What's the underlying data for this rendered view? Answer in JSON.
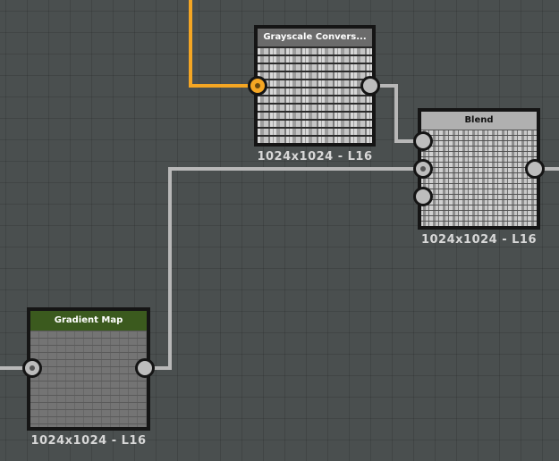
{
  "colors": {
    "canvas": "#4a4f4f",
    "wire_gray": "#b8b8b8",
    "wire_orange": "#f5a623",
    "node_frame": "#151515",
    "gradient_map_header": "#3b5a1e",
    "grayscale_header": "#6b6b6b",
    "blend_header": "#b0b0b0"
  },
  "nodes": {
    "grayscale": {
      "title": "Grayscale Convers...",
      "resolution": "1024x1024 - L16"
    },
    "blend": {
      "title": "Blend",
      "resolution": "1024x1024 - L16"
    },
    "gradient_map": {
      "title": "Gradient Map",
      "resolution": "1024x1024 - L16"
    }
  }
}
